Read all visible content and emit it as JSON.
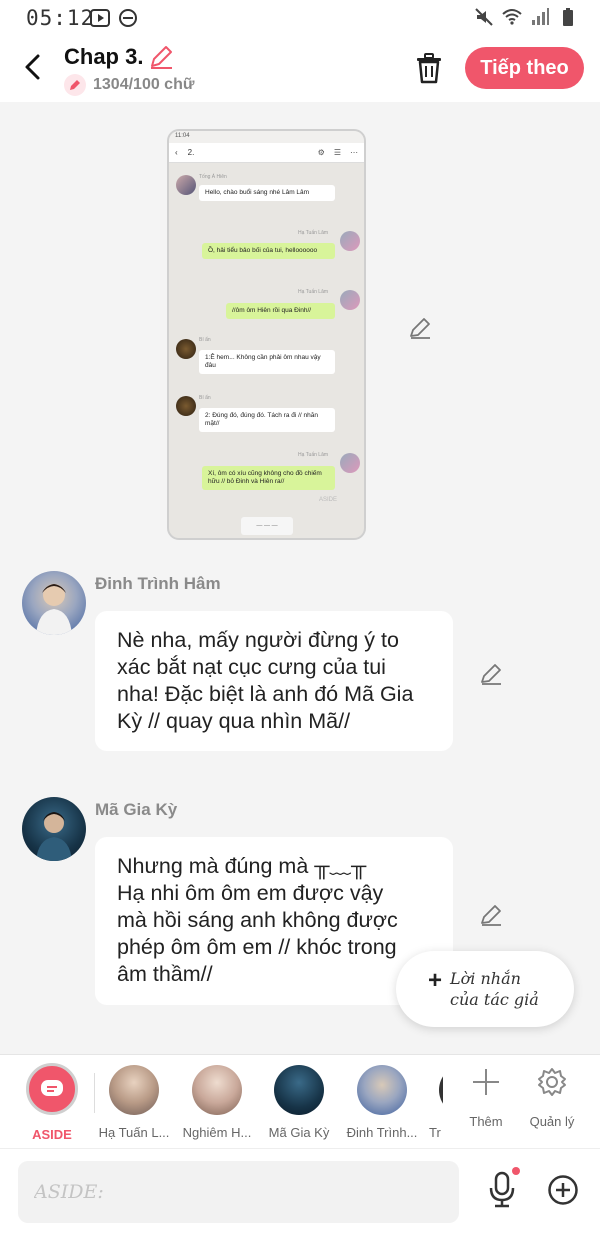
{
  "status": {
    "time": "05:12"
  },
  "header": {
    "title": "Chap 3.",
    "word_count": "1304/100 chữ",
    "next_label": "Tiếp theo"
  },
  "embed": {
    "title": "2.",
    "status_time": "11:04",
    "messages": [
      {
        "name": "Tống Á Hiên",
        "text": "Hello, chào buổi sáng nhé Lâm Lâm"
      },
      {
        "name": "Hạ Tuấn Lâm",
        "text": "Ồ, hải tiểu bảo bối của tui, helloooooo"
      },
      {
        "name": "Hạ Tuấn Lâm",
        "text": "//ôm ôm Hiên rồi qua Đinh//"
      },
      {
        "name": "Bí ẩn",
        "text": "1:Ê hem... Không cần phải ôm nhau vậy đâu"
      },
      {
        "name": "Bí ẩn",
        "text": "2: Đúng đó, đúng đó. Tách ra đi // nhăn mặt//"
      },
      {
        "name": "Hạ Tuấn Lâm",
        "text": "Xí, ôm có xíu cũng không cho đồ chiếm hữu // bỏ Đinh và Hiên ra//"
      }
    ],
    "bottom_label": "— — —",
    "watermark": "ASIDE"
  },
  "messages": [
    {
      "name": "Đinh Trình Hâm",
      "lines": [
        "Nè nha, mấy người đừng ý to",
        "xác bắt nạt cục cưng của tui",
        "nha! Đặc biệt là anh đó Mã Gia",
        "Kỳ // quay qua nhìn Mã//"
      ]
    },
    {
      "name": "Mã Gia Kỳ",
      "lines": [
        "Nhưng mà đúng mà ╥﹏╥",
        "Hạ nhi ôm ôm em được vậy",
        "mà hồi sáng anh không được",
        "phép ôm ôm em // khóc trong",
        "âm thầm//"
      ]
    }
  ],
  "float_note": {
    "line1": "Lời nhắn",
    "line2": "của tác giả"
  },
  "char_bar": {
    "aside_label": "ASIDE",
    "characters": [
      "Hạ Tuấn L...",
      "Nghiêm H...",
      "Mã Gia Kỳ",
      "Đinh Trình...",
      "Tr"
    ],
    "add_label": "Thêm",
    "manage_label": "Quản lý"
  },
  "input": {
    "placeholder": "ASIDE:"
  },
  "colors": {
    "accent": "#f0566b",
    "bubble_green": "#d8f49a"
  }
}
